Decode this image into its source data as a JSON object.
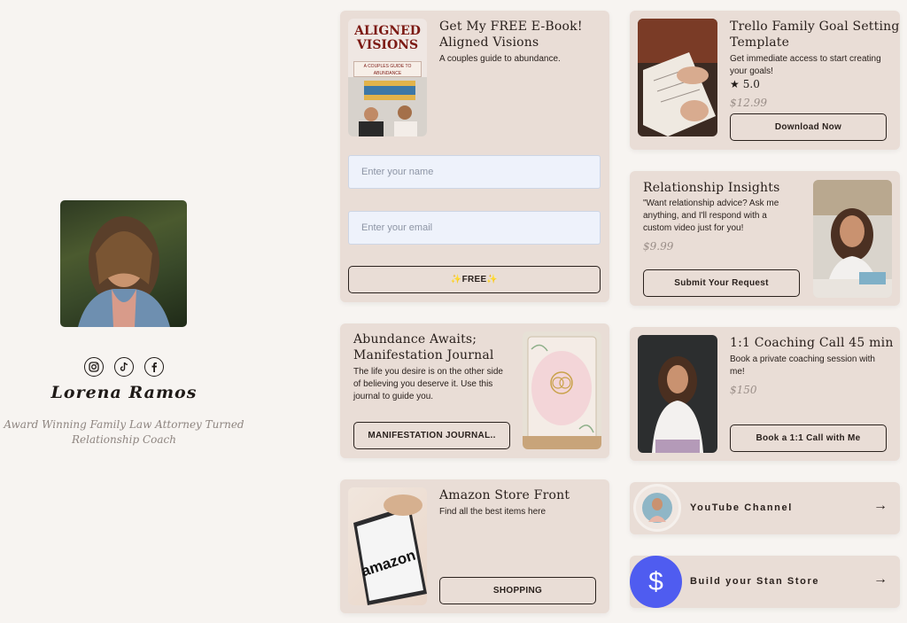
{
  "profile": {
    "name": "Lorena Ramos",
    "bio_line1": "Award Winning Family Law Attorney Turned",
    "bio_line2": "Relationship Coach",
    "socials": [
      "instagram-icon",
      "tiktok-icon",
      "facebook-icon"
    ]
  },
  "ebook": {
    "cover_title_line1": "ALIGNED",
    "cover_title_line2": "VISIONS",
    "cover_subtitle": "A COUPLES GUIDE TO ABUNDANCE",
    "title_line1": "Get My FREE E-Book!",
    "title_line2": "Aligned Visions",
    "description": "A couples guide to abundance.",
    "name_placeholder": "Enter your name",
    "email_placeholder": "Enter your email",
    "button": "✨FREE✨"
  },
  "trello": {
    "title_line1": "Trello Family Goal Setting",
    "title_line2": "Template",
    "desc_line1": "Get immediate access to start creating",
    "desc_line2": "your goals!",
    "rating": "5.0",
    "price": "$12.99",
    "button": "Download Now"
  },
  "insights": {
    "title": "Relationship Insights",
    "desc_line1": "\"Want relationship advice? Ask me",
    "desc_line2": "anything, and I'll respond with a",
    "desc_line3": "custom video just for you!",
    "price": "$9.99",
    "button": "Submit Your Request"
  },
  "journal": {
    "title_line1": "Abundance Awaits;",
    "title_line2": "Manifestation Journal",
    "desc_line1": "The life you desire is on the other side",
    "desc_line2": "of believing you deserve it. Use this",
    "desc_line3": "journal to guide you.",
    "button": "MANIFESTATION JOURNAL.."
  },
  "coaching": {
    "title": "1:1 Coaching Call 45 min",
    "desc_line1": "Book a private coaching session with",
    "desc_line2": "me!",
    "price": "$150",
    "button": "Book a 1:1 Call with Me"
  },
  "amazon": {
    "title": "Amazon Store Front",
    "description": "Find all the best items here",
    "logo_text": "amazon",
    "button": "SHOPPING"
  },
  "links": {
    "youtube": "YouTube Channel",
    "stan": "Build your Stan Store"
  },
  "colors": {
    "page_bg": "#f7f4f1",
    "card_bg": "#e9ddd6",
    "input_bg": "#eef2fb",
    "stan_blue": "#4f5cf0",
    "price_gray": "#9a8e88"
  }
}
